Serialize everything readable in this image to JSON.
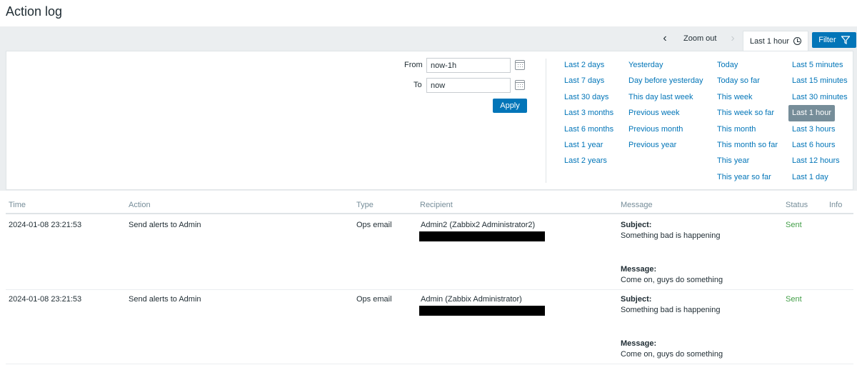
{
  "page": {
    "title": "Action log"
  },
  "time_nav": {
    "prev_icon": "chevron-left-icon",
    "zoom_out_label": "Zoom out",
    "next_icon": "chevron-right-icon",
    "range_label": "Last 1 hour",
    "clock_icon": "clock-icon",
    "filter_label": "Filter",
    "filter_icon": "funnel-icon"
  },
  "filter": {
    "from_label": "From",
    "from_value": "now-1h",
    "to_label": "To",
    "to_value": "now",
    "apply_label": "Apply",
    "quick_columns": [
      [
        "Last 2 days",
        "Last 7 days",
        "Last 30 days",
        "Last 3 months",
        "Last 6 months",
        "Last 1 year",
        "Last 2 years"
      ],
      [
        "Yesterday",
        "Day before yesterday",
        "This day last week",
        "Previous week",
        "Previous month",
        "Previous year"
      ],
      [
        "Today",
        "Today so far",
        "This week",
        "This week so far",
        "This month",
        "This month so far",
        "This year",
        "This year so far"
      ],
      [
        "Last 5 minutes",
        "Last 15 minutes",
        "Last 30 minutes",
        "Last 1 hour",
        "Last 3 hours",
        "Last 6 hours",
        "Last 12 hours",
        "Last 1 day"
      ]
    ],
    "active_quick": "Last 1 hour"
  },
  "table": {
    "headers": {
      "time": "Time",
      "action": "Action",
      "type": "Type",
      "recipient": "Recipient",
      "message": "Message",
      "status": "Status",
      "info": "Info"
    },
    "rows": [
      {
        "time": "2024-01-08 23:21:53",
        "action": "Send alerts to Admin",
        "type": "Ops email",
        "recipient": "Admin2 (Zabbix2 Administrator2)",
        "subject_label": "Subject:",
        "subject": "Something bad is happening",
        "message_label": "Message:",
        "message": "Come on, guys do something",
        "status": "Sent"
      },
      {
        "time": "2024-01-08 23:21:53",
        "action": "Send alerts to Admin",
        "type": "Ops email",
        "recipient": "Admin (Zabbix Administrator)",
        "subject_label": "Subject:",
        "subject": "Something bad is happening",
        "message_label": "Message:",
        "message": "Come on, guys do something",
        "status": "Sent"
      }
    ]
  },
  "colors": {
    "accent": "#0275b8",
    "active_quick_bg": "#768d99",
    "status_sent": "#429e47",
    "header_text": "#768d99"
  }
}
